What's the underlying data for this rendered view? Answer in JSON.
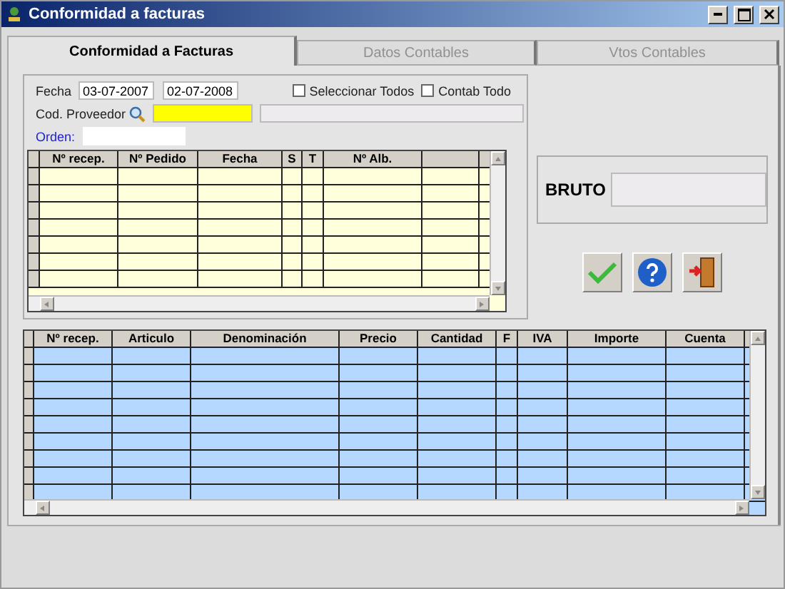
{
  "window": {
    "title": "Conformidad a facturas"
  },
  "tabs": [
    {
      "label": "Conformidad a Facturas",
      "selected": true
    },
    {
      "label": "Datos Contables",
      "selected": false
    },
    {
      "label": "Vtos Contables",
      "selected": false
    }
  ],
  "filters": {
    "fecha_label": "Fecha",
    "fecha_desde": "03-07-2007",
    "fecha_hasta": "02-07-2008",
    "checkboxes": [
      {
        "label": "Seleccionar Todos",
        "checked": false
      },
      {
        "label": "Contab Todo",
        "checked": false
      }
    ],
    "proveedor_label": "Cod. Proveedor",
    "orden_label": "Orden:"
  },
  "top_grid": {
    "columns": [
      "Nº recep.",
      "Nº Pedido",
      "Fecha",
      "S",
      "T",
      "Nº Alb."
    ]
  },
  "bruto": {
    "label": "BRUTO"
  },
  "bottom_grid": {
    "columns": [
      "Nº recep.",
      "Articulo",
      "Denominación",
      "Precio",
      "Cantidad",
      "F",
      "IVA",
      "Importe",
      "Cuenta"
    ]
  }
}
